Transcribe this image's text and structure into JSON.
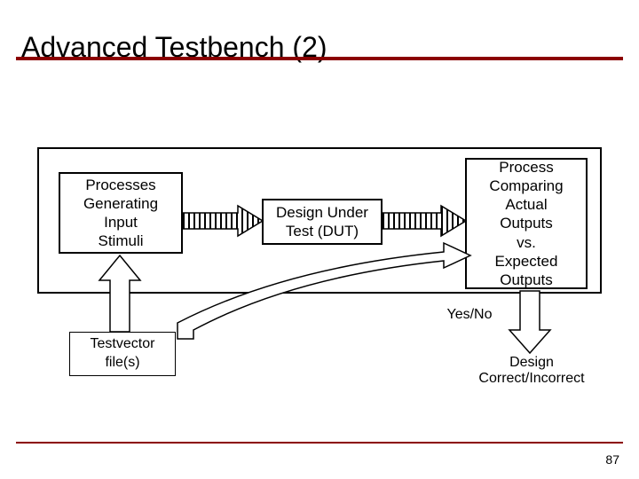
{
  "title": "Advanced Testbench (2)",
  "page_number": "87",
  "blocks": {
    "stimuli": "Processes\nGenerating\nInput\nStimuli",
    "dut": "Design Under\nTest (DUT)",
    "compare": "Process\nComparing\nActual\nOutputs\nvs.\nExpected\nOutputs",
    "testvector": "Testvector\nfile(s)"
  },
  "labels": {
    "yesno": "Yes/No",
    "result": "Design\nCorrect/Incorrect"
  }
}
